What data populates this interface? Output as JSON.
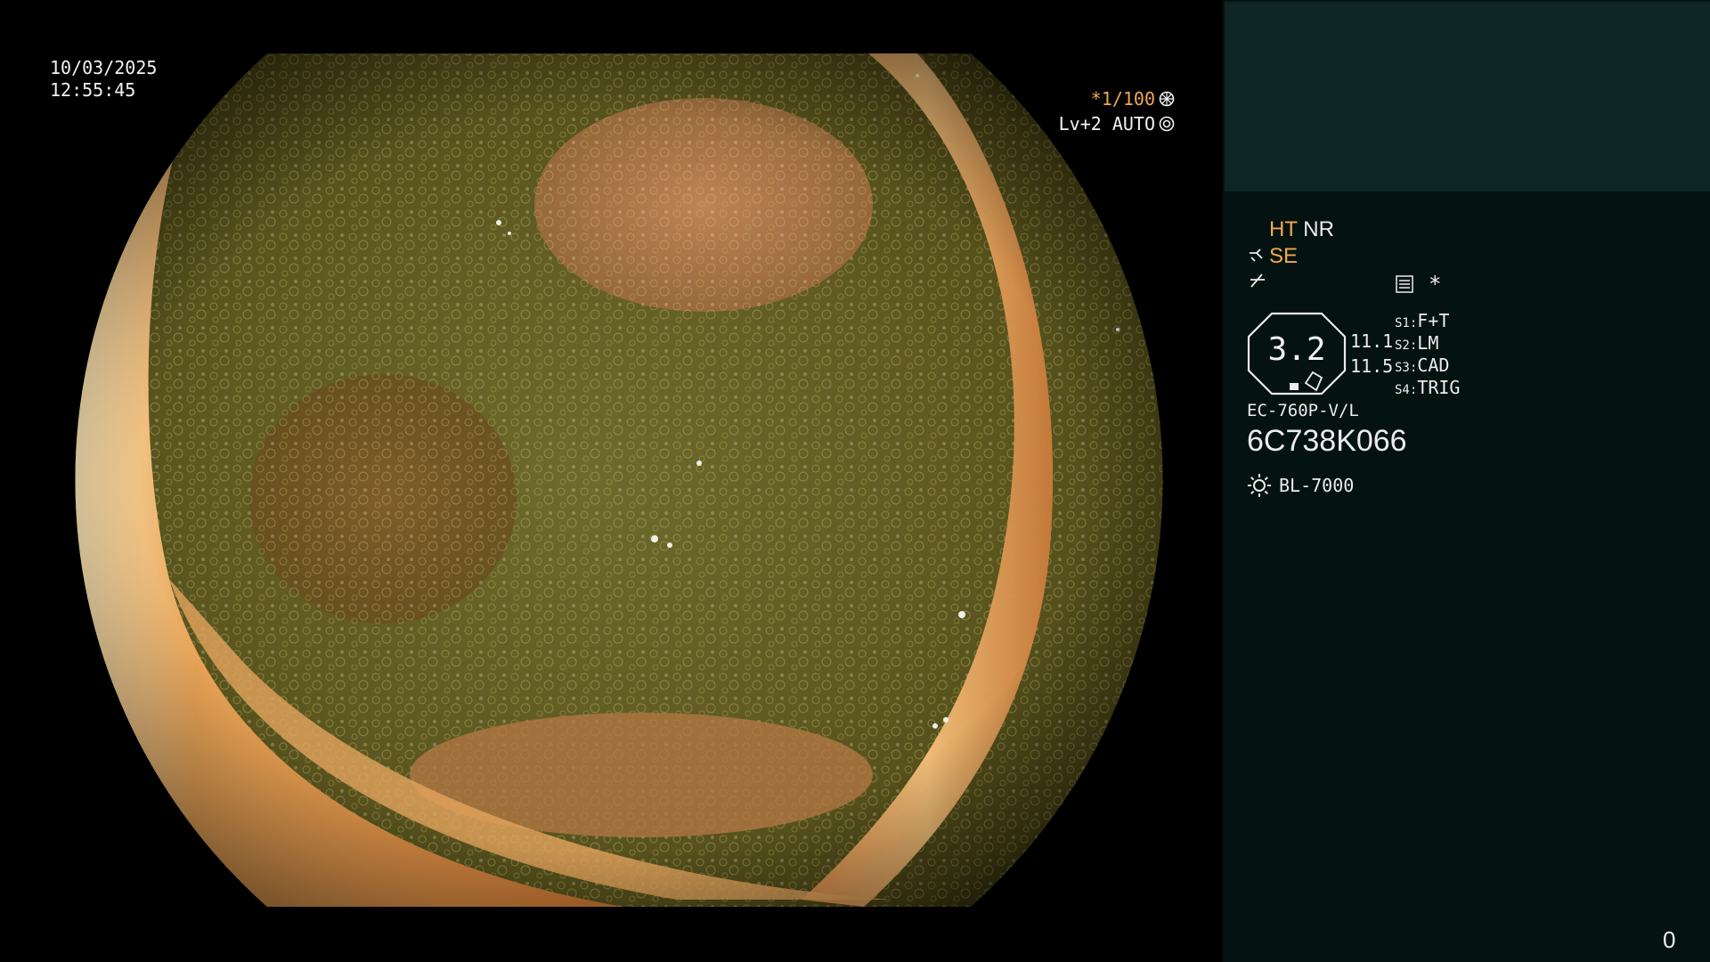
{
  "overlay": {
    "date": "10/03/2025",
    "time": "12:55:45",
    "shutter": "*1/100",
    "iris": "Lv+2 AUTO",
    "shutter_icon": "aperture-icon",
    "iris_icon": "target-icon"
  },
  "panel": {
    "ht_label": "HT",
    "nr_label": "NR",
    "se_label": "SE",
    "se_icon": "enhancement-icon",
    "filter_icon": "filter-icon",
    "settings_icon": "menu-settings-icon",
    "settings_star": "*",
    "zoom_value": "3.2",
    "measure_1": "11.1",
    "measure_2": "11.5",
    "switches": [
      {
        "key": "S1:",
        "value": "F+T"
      },
      {
        "key": "S2:",
        "value": "LM"
      },
      {
        "key": "S3:",
        "value": "CAD"
      },
      {
        "key": "S4:",
        "value": "TRIG"
      }
    ],
    "scope_model": "EC-760P-V/L",
    "scope_serial": "6C738K066",
    "light_icon": "sun-icon",
    "light_source": "BL-7000",
    "counter": "0"
  },
  "colors": {
    "accent_orange": "#f0a850",
    "panel_bg": "#041311",
    "panel_top_bg": "#0e2623",
    "text": "#ececec"
  }
}
